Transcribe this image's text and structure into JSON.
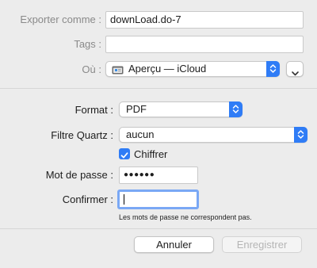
{
  "export": {
    "label": "Exporter comme :",
    "value": "downLoad.do-7"
  },
  "tags": {
    "label": "Tags :",
    "value": ""
  },
  "location": {
    "label": "Où :",
    "value": "Aperçu — iCloud"
  },
  "format": {
    "label": "Format :",
    "value": "PDF"
  },
  "quartz_filter": {
    "label": "Filtre Quartz :",
    "value": "aucun"
  },
  "encrypt": {
    "label": "Chiffrer",
    "checked": true
  },
  "password": {
    "label": "Mot de passe :",
    "masked": "●●●●●●"
  },
  "confirm": {
    "label": "Confirmer :",
    "value": ""
  },
  "error_message": "Les mots de passe ne correspondent pas.",
  "buttons": {
    "cancel": "Annuler",
    "save": "Enregistrer"
  },
  "colors": {
    "accent": "#2f7cf6",
    "background": "#ececec"
  },
  "icons": {
    "location": "folder-icon",
    "expand": "chevron-down-icon",
    "checkbox": "checkmark-icon"
  }
}
